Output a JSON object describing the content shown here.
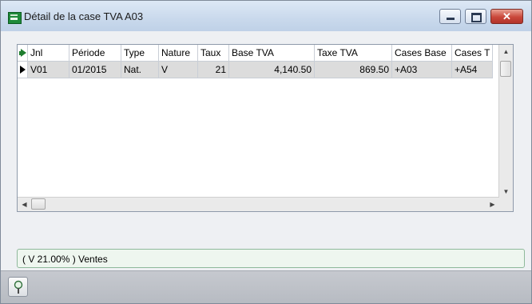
{
  "window": {
    "title": "Détail de la case TVA A03"
  },
  "grid": {
    "columns": [
      "Jnl",
      "Période",
      "Type",
      "Nature",
      "Taux",
      "Base TVA",
      "Taxe TVA",
      "Cases Base",
      "Cases T"
    ],
    "rows": [
      {
        "jnl": "V01",
        "periode": "01/2015",
        "type": "Nat.",
        "nature": "V",
        "taux": "21",
        "base_tva": "4,140.50",
        "taxe_tva": "869.50",
        "cases_base": "+A03",
        "cases_t": "+A54"
      }
    ]
  },
  "status": {
    "text": "( V 21.00% ) Ventes"
  },
  "icons": {
    "app": "app-icon",
    "minimize": "minimize-icon",
    "maximize": "maximize-icon",
    "close": "close-icon",
    "bottom_tool": "pin-icon"
  },
  "colors": {
    "status_border": "#8fb99b",
    "close_button": "#c9473a",
    "indicator_green": "#1e7d2e"
  }
}
